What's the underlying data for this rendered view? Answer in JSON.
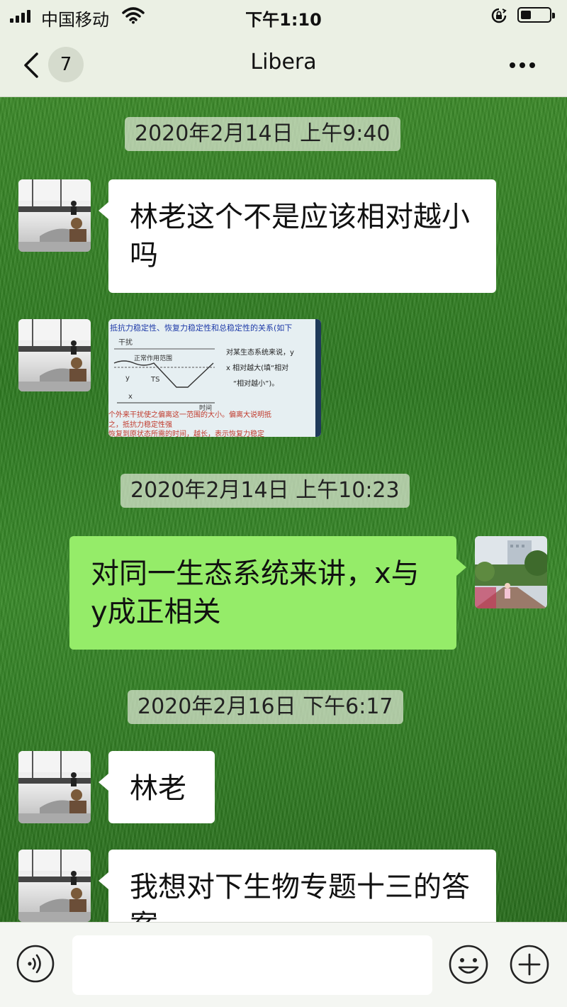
{
  "status_bar": {
    "carrier": "中国移动",
    "time": "下午1:10",
    "signal_bars": 4,
    "battery_level": 0.3
  },
  "nav": {
    "back_icon": "chevron-left-icon",
    "unread_count": "7",
    "title": "Libera",
    "more_icon": "more-dots-icon"
  },
  "messages": [
    {
      "type": "timestamp",
      "text": "2020年2月14日 上午9:40"
    },
    {
      "type": "text",
      "direction": "incoming",
      "text": "林老这个不是应该相对越小吗"
    },
    {
      "type": "image",
      "direction": "incoming",
      "image": {
        "header": "抵抗力稳定性、恢复力稳定性和总稳定性的关系(如下",
        "label_disturb": "干扰",
        "label_range": "正常作用范围",
        "label_y": "y",
        "label_ts": "TS",
        "label_x": "x",
        "label_time": "时间",
        "q1": "对某生态系统来说，y",
        "q2": "x 相对越大(填“相对",
        "q3": "“相对越小”)。",
        "foot1": "个外来干扰使之偏离这一范围的大小。偏离大说明抵",
        "foot2": "之，抵抗力稳定性强",
        "foot3": "恢复到原状态所需的时间，越长，表示恢复力稳定"
      }
    },
    {
      "type": "timestamp",
      "text": "2020年2月14日 上午10:23"
    },
    {
      "type": "text",
      "direction": "outgoing",
      "text": "对同一生态系统来讲，x与y成正相关"
    },
    {
      "type": "timestamp",
      "text": "2020年2月16日 下午6:17"
    },
    {
      "type": "text",
      "direction": "incoming",
      "text": "林老"
    },
    {
      "type": "text",
      "direction": "incoming",
      "text": "我想对下生物专题十三的答案"
    }
  ],
  "input_bar": {
    "voice_icon": "voice-icon",
    "input_value": "",
    "emoji_icon": "emoji-icon",
    "plus_icon": "plus-circle-icon"
  },
  "colors": {
    "bar_bg": "#ebf0e4",
    "outgoing_bubble": "#95ec69",
    "incoming_bubble": "#ffffff",
    "grass": "#3a8a2a"
  }
}
